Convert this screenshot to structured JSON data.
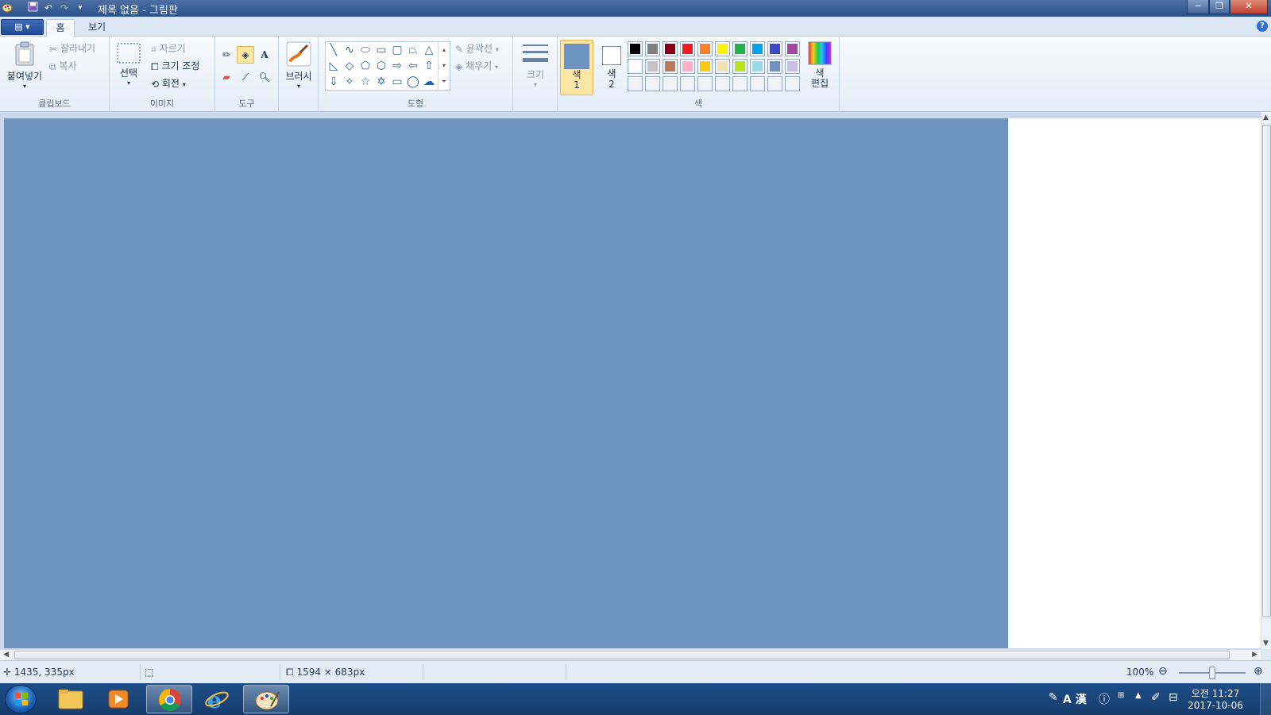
{
  "window": {
    "title": "제목 없음 - 그림판",
    "buttons": {
      "minimize": "─",
      "maximize": "❐",
      "close": "✕"
    }
  },
  "tabs": {
    "file_menu": "▤ ▾",
    "home": "홈",
    "view": "보기"
  },
  "ribbon": {
    "clipboard": {
      "label": "클립보드",
      "paste": "붙여넣기",
      "cut": "잘라내기",
      "copy": "복사"
    },
    "image": {
      "label": "이미지",
      "select": "선택",
      "crop": "자르기",
      "resize": "크기 조정",
      "rotate": "회전"
    },
    "tools": {
      "label": "도구"
    },
    "brush": {
      "label": "브러시"
    },
    "shapes": {
      "label": "도형",
      "outline": "윤곽선",
      "fill": "채우기"
    },
    "size": {
      "label": "크기"
    },
    "colors": {
      "label": "색",
      "color1": "색\n1",
      "color1_line1": "색",
      "color1_line2": "1",
      "color2_line1": "색",
      "color2_line2": "2",
      "edit_line1": "색",
      "edit_line2": "편집",
      "color1_value": "#6f93c0",
      "color2_value": "#ffffff",
      "palette_row1": [
        "#000000",
        "#7f7f7f",
        "#880015",
        "#ed1c24",
        "#ff7f27",
        "#fff200",
        "#22b14c",
        "#00a2e8",
        "#3f48cc",
        "#a349a4"
      ],
      "palette_row2": [
        "#ffffff",
        "#c3c3c3",
        "#b97a57",
        "#ffaec9",
        "#ffc90e",
        "#efe4b0",
        "#b5e61d",
        "#99d9ea",
        "#7092be",
        "#c8bfe7"
      ]
    }
  },
  "canvas": {
    "fill_color": "#6f93c0"
  },
  "status": {
    "cursor_pos": "1435, 335px",
    "canvas_size": "1594 × 683px",
    "zoom": "100%"
  },
  "taskbar": {
    "apps": [
      "file-explorer",
      "media-player",
      "chrome",
      "internet-explorer",
      "paint"
    ],
    "ime": "A 漢",
    "time": "오전 11:27",
    "date": "2017-10-06"
  }
}
